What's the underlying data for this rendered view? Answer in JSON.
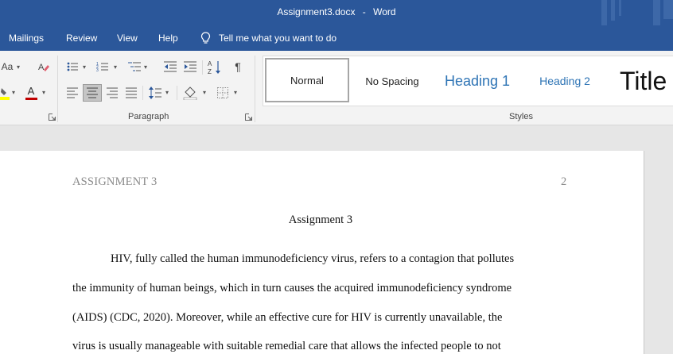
{
  "window": {
    "filename": "Assignment3.docx",
    "separator": "-",
    "app": "Word"
  },
  "tabs": [
    "Mailings",
    "Review",
    "View",
    "Help"
  ],
  "tell_me": "Tell me what you want to do",
  "ribbon": {
    "font_group": {
      "change_case_label": "Aa",
      "font_color_label": "A"
    },
    "paragraph_group": {
      "label": "Paragraph",
      "sort_label": "A↓Z",
      "pilcrow": "¶"
    },
    "styles_group": {
      "label": "Styles",
      "items": [
        "Normal",
        "No Spacing",
        "Heading 1",
        "Heading 2",
        "Title"
      ]
    }
  },
  "colors": {
    "brand": "#2b579a",
    "heading": "#2e74b5",
    "font_color": "#c00000",
    "highlight": "#ffff00"
  },
  "document": {
    "header_left": "ASSIGNMENT 3",
    "page_number": "2",
    "title": "Assignment 3",
    "lines": [
      "HIV, fully called the human immunodeficiency virus, refers to a contagion that pollutes",
      "the immunity of human beings, which in turn causes the acquired immunodeficiency syndrome",
      "(AIDS) (CDC, 2020). Moreover, while an effective cure for HIV is currently unavailable, the",
      "virus is usually manageable with suitable remedial care that allows the infected people to not"
    ]
  }
}
